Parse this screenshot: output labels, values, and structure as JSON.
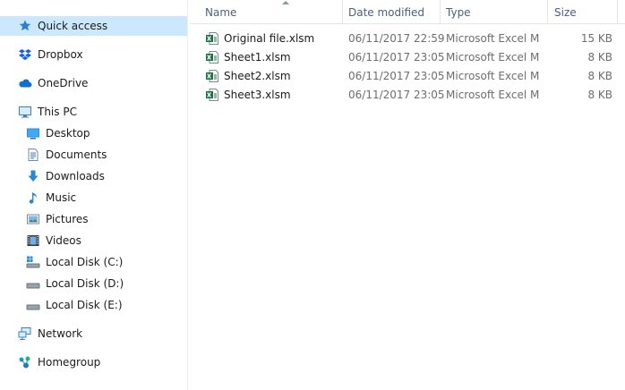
{
  "sidebar": {
    "items": [
      {
        "label": "Quick access",
        "icon": "star-pin-icon",
        "selected": true
      },
      {
        "label": "Dropbox",
        "icon": "dropbox-icon"
      },
      {
        "label": "OneDrive",
        "icon": "cloud-icon"
      },
      {
        "label": "This PC",
        "icon": "monitor-icon"
      },
      {
        "label": "Desktop",
        "icon": "desktop-folder-icon"
      },
      {
        "label": "Documents",
        "icon": "documents-icon"
      },
      {
        "label": "Downloads",
        "icon": "download-arrow-icon"
      },
      {
        "label": "Music",
        "icon": "music-note-icon"
      },
      {
        "label": "Pictures",
        "icon": "pictures-icon"
      },
      {
        "label": "Videos",
        "icon": "film-icon"
      },
      {
        "label": "Local Disk (C:)",
        "icon": "windows-drive-icon"
      },
      {
        "label": "Local Disk (D:)",
        "icon": "drive-icon"
      },
      {
        "label": "Local Disk (E:)",
        "icon": "drive-icon"
      },
      {
        "label": "Network",
        "icon": "network-icon"
      },
      {
        "label": "Homegroup",
        "icon": "homegroup-icon"
      }
    ]
  },
  "columns": {
    "name": "Name",
    "date": "Date modified",
    "type": "Type",
    "size": "Size",
    "sort_column": "Name",
    "sort_direction": "ascending"
  },
  "files": [
    {
      "name": "Original file.xlsm",
      "date": "06/11/2017 22:59",
      "type": "Microsoft Excel M...",
      "size": "15 KB"
    },
    {
      "name": "Sheet1.xlsm",
      "date": "06/11/2017 23:05",
      "type": "Microsoft Excel M...",
      "size": "8 KB"
    },
    {
      "name": "Sheet2.xlsm",
      "date": "06/11/2017 23:05",
      "type": "Microsoft Excel M...",
      "size": "8 KB"
    },
    {
      "name": "Sheet3.xlsm",
      "date": "06/11/2017 23:05",
      "type": "Microsoft Excel M...",
      "size": "8 KB"
    }
  ],
  "colors": {
    "selection": "#cce8ff",
    "header_text": "#4c607a",
    "excel_green": "#1d7044"
  }
}
